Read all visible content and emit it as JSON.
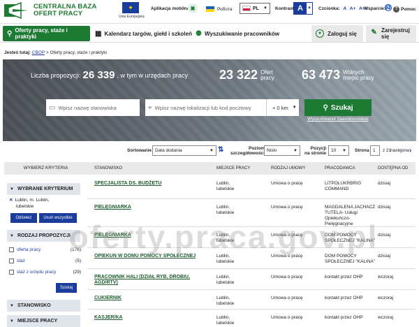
{
  "logo": {
    "line1": "CENTRALNA BAZA",
    "line2": "OFERT PRACY"
  },
  "eu": {
    "label": "Unia Europejska"
  },
  "topbar": {
    "app": "Aplikacja mobilna",
    "ukraine": "Робота",
    "lang": "PL",
    "kontrast": "Kontrast:",
    "kontrast_value": "A",
    "czcionka": "Czcionka:",
    "font_sizes": [
      "A",
      "A+",
      "A++"
    ],
    "wsparcie": "Wsparcie:",
    "pomoc": "Pomoc"
  },
  "nav": {
    "oferty": "Oferty pracy, staże i praktyki",
    "kalendarz": "Kalendarz targów, giełd i szkoleń",
    "wyszukiwanie": "Wyszukiwanie pracowników",
    "zaloguj": "Zaloguj się",
    "zarejestruj": "Zarejestruj się"
  },
  "breadcrumb": {
    "prefix": "Jesteś tutaj:",
    "home": "CBOP",
    "current": "> Oferty pracy, staże i praktyki"
  },
  "hero": {
    "liczba_label": "Liczba propozycji:",
    "liczba_value": "26 339",
    "liczba_suffix": ", w tym w urzędach pracy",
    "oferty_value": "23 322",
    "oferty_l1": "Ofert",
    "oferty_l2": "pracy",
    "wolne_value": "63 473",
    "wolne_l1": "Wolnych",
    "wolne_l2": "miejsc pracy",
    "stanowisko_placeholder": "Wpisz nazwę stanowiska",
    "lokalizacja_placeholder": "Wpisz nazwę lokalizacji lub kod pocztowy",
    "distance": "+ 0 km",
    "search": "Szukaj",
    "advanced": "Wyszukiwanie zaawansowane"
  },
  "sortbar": {
    "sortowanie": "Sortowanie",
    "sort_value": "Data dodania",
    "poziom_l1": "Poziom",
    "poziom_l2": "szczegółowości",
    "poziom_value": "Niski",
    "pozycji_l1": "Pozycji",
    "pozycji_l2": "na stronie",
    "pozycji_value": "10",
    "strona": "Strona",
    "strona_value": "1",
    "z": "z 21",
    "nastepna": "następna"
  },
  "sidebar": {
    "header": "WYBIERZ KRYTERIA",
    "wybrane": "WYBRANE KRYTERIUM",
    "tag_l1": "Lublin, m. Lublin,",
    "tag_l2": "lubelskie",
    "odswiez": "Odśwież",
    "usun": "Usuń wszystkie",
    "rodzaj": "RODZAJ PROPOZYCJI",
    "options": [
      {
        "label": "oferta pracy",
        "count": "(176)"
      },
      {
        "label": "staż",
        "count": "(5)"
      },
      {
        "label": "staż z urzędu pracy",
        "count": "(29)"
      }
    ],
    "szukaj": "Szukaj",
    "stanowisko": "STANOWISKO",
    "miejsce": "MIEJSCE PRACY"
  },
  "table": {
    "headers": [
      "STANOWISKO",
      "MIEJSCE PRACY",
      "RODZAJ UMOWY",
      "PRACODAWCA",
      "DOSTĘPNA OD"
    ],
    "rows": [
      {
        "title": "SPECJALISTA DS. BUDŻETU",
        "place_l1": "Lublin,",
        "place_l2": "lubelskie",
        "umowa": "Umowa o pracę",
        "emp_l1": "LITPOLUKRBRIG",
        "emp_l2": "COMMAND",
        "emp_l3": "",
        "emp_l4": "",
        "od": "dzisiaj"
      },
      {
        "title": "PIELĘGNIARKA",
        "place_l1": "Lublin,",
        "place_l2": "lubelskie",
        "umowa": "Umowa o pracę",
        "emp_l1": "MAGDALENA JACHACZ",
        "emp_l2": "TUTELA- Usługi",
        "emp_l3": "Opiekuńczo-",
        "emp_l4": "Pielęgnacyjne",
        "od": "dzisiaj"
      },
      {
        "title": "PIELĘGNIARKA",
        "place_l1": "Lublin,",
        "place_l2": "lubelskie",
        "umowa": "Umowa o pracę",
        "emp_l1": "DOM POMOCY",
        "emp_l2": "SPOŁECZNEJ \"KALINA\"",
        "emp_l3": "",
        "emp_l4": "",
        "od": "dzisiaj"
      },
      {
        "title": "OPIEKUN W DOMU POMOCY SPOŁECZNEJ",
        "place_l1": "Lublin,",
        "place_l2": "lubelskie",
        "umowa": "Umowa o pracę",
        "emp_l1": "DOM POMOCY",
        "emp_l2": "SPOŁECZNEJ \"KALINA\"",
        "emp_l3": "",
        "emp_l4": "",
        "od": "dzisiaj"
      },
      {
        "title": "PRACOWNIK HALI (DZIAŁ RYB, DROBIU,",
        "title2": "AGD/RTV)",
        "place_l1": "Lublin,",
        "place_l2": "lubelskie",
        "umowa": "Umowa o pracę",
        "emp_l1": "kontakt przez OHP",
        "emp_l2": "",
        "emp_l3": "",
        "emp_l4": "",
        "od": "wczoraj"
      },
      {
        "title": "CUKIERNIK",
        "place_l1": "Lublin,",
        "place_l2": "lubelskie",
        "umowa": "Umowa o pracę",
        "emp_l1": "kontakt przez OHP",
        "emp_l2": "",
        "emp_l3": "",
        "emp_l4": "",
        "od": "wczoraj"
      },
      {
        "title": "KASJER/KA",
        "place_l1": "Lublin,",
        "place_l2": "lubelskie",
        "umowa": "Umowa o pracę",
        "emp_l1": "kontakt przez OHP",
        "emp_l2": "",
        "emp_l3": "",
        "emp_l4": "",
        "od": "wczoraj"
      }
    ]
  },
  "watermark": "oferty.praca.gov.pl"
}
